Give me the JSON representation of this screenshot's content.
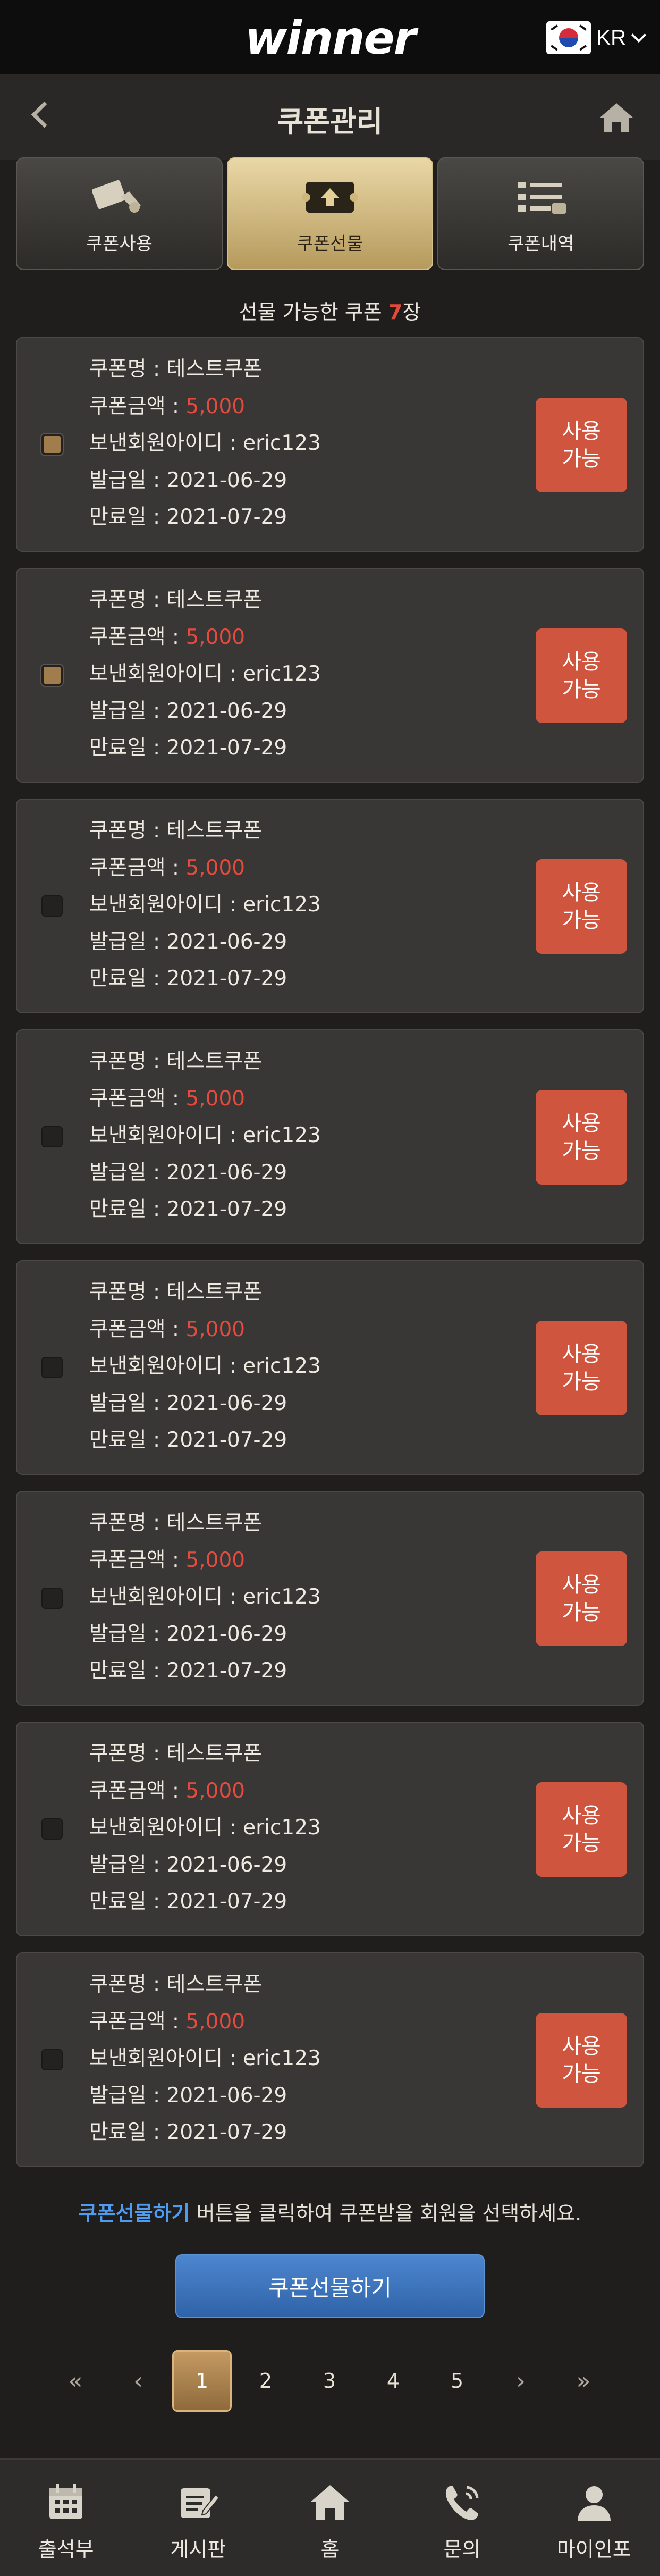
{
  "top": {
    "logo": "winner",
    "lang": "KR"
  },
  "header": {
    "title": "쿠폰관리"
  },
  "tabs": [
    {
      "label": "쿠폰사용",
      "icon": "coupon-use-icon",
      "active": false
    },
    {
      "label": "쿠폰선물",
      "icon": "coupon-gift-icon",
      "active": true
    },
    {
      "label": "쿠폰내역",
      "icon": "coupon-history-icon",
      "active": false
    }
  ],
  "count": {
    "prefix": "선물 가능한 쿠폰 ",
    "num": "7",
    "suffix": "장"
  },
  "labels": {
    "name": "쿠폰명 : ",
    "amount": "쿠폰금액 : ",
    "sender": "보낸회원아이디 : ",
    "issued": "발급일 : ",
    "expires": "만료일 : ",
    "use_button": "사용\n가능"
  },
  "coupons": [
    {
      "name": "테스트쿠폰",
      "amount": "5,000",
      "sender": "eric123",
      "issued": "2021-06-29",
      "expires": "2021-07-29",
      "checked": true
    },
    {
      "name": "테스트쿠폰",
      "amount": "5,000",
      "sender": "eric123",
      "issued": "2021-06-29",
      "expires": "2021-07-29",
      "checked": true
    },
    {
      "name": "테스트쿠폰",
      "amount": "5,000",
      "sender": "eric123",
      "issued": "2021-06-29",
      "expires": "2021-07-29",
      "checked": false
    },
    {
      "name": "테스트쿠폰",
      "amount": "5,000",
      "sender": "eric123",
      "issued": "2021-06-29",
      "expires": "2021-07-29",
      "checked": false
    },
    {
      "name": "테스트쿠폰",
      "amount": "5,000",
      "sender": "eric123",
      "issued": "2021-06-29",
      "expires": "2021-07-29",
      "checked": false
    },
    {
      "name": "테스트쿠폰",
      "amount": "5,000",
      "sender": "eric123",
      "issued": "2021-06-29",
      "expires": "2021-07-29",
      "checked": false
    },
    {
      "name": "테스트쿠폰",
      "amount": "5,000",
      "sender": "eric123",
      "issued": "2021-06-29",
      "expires": "2021-07-29",
      "checked": false
    },
    {
      "name": "테스트쿠폰",
      "amount": "5,000",
      "sender": "eric123",
      "issued": "2021-06-29",
      "expires": "2021-07-29",
      "checked": false
    }
  ],
  "note": {
    "highlight": "쿠폰선물하기",
    "text": " 버튼을 클릭하여 쿠폰받을 회원을 선택하세요."
  },
  "gift_button": "쿠폰선물하기",
  "pagination": {
    "first": "«",
    "prev": "‹",
    "pages": [
      "1",
      "2",
      "3",
      "4",
      "5"
    ],
    "current": "1",
    "next": "›",
    "last": "»"
  },
  "bottom_nav": [
    {
      "label": "출석부",
      "icon": "calendar-icon"
    },
    {
      "label": "게시판",
      "icon": "board-icon"
    },
    {
      "label": "홈",
      "icon": "home-icon"
    },
    {
      "label": "문의",
      "icon": "phone-icon"
    },
    {
      "label": "마이인포",
      "icon": "user-icon"
    }
  ]
}
